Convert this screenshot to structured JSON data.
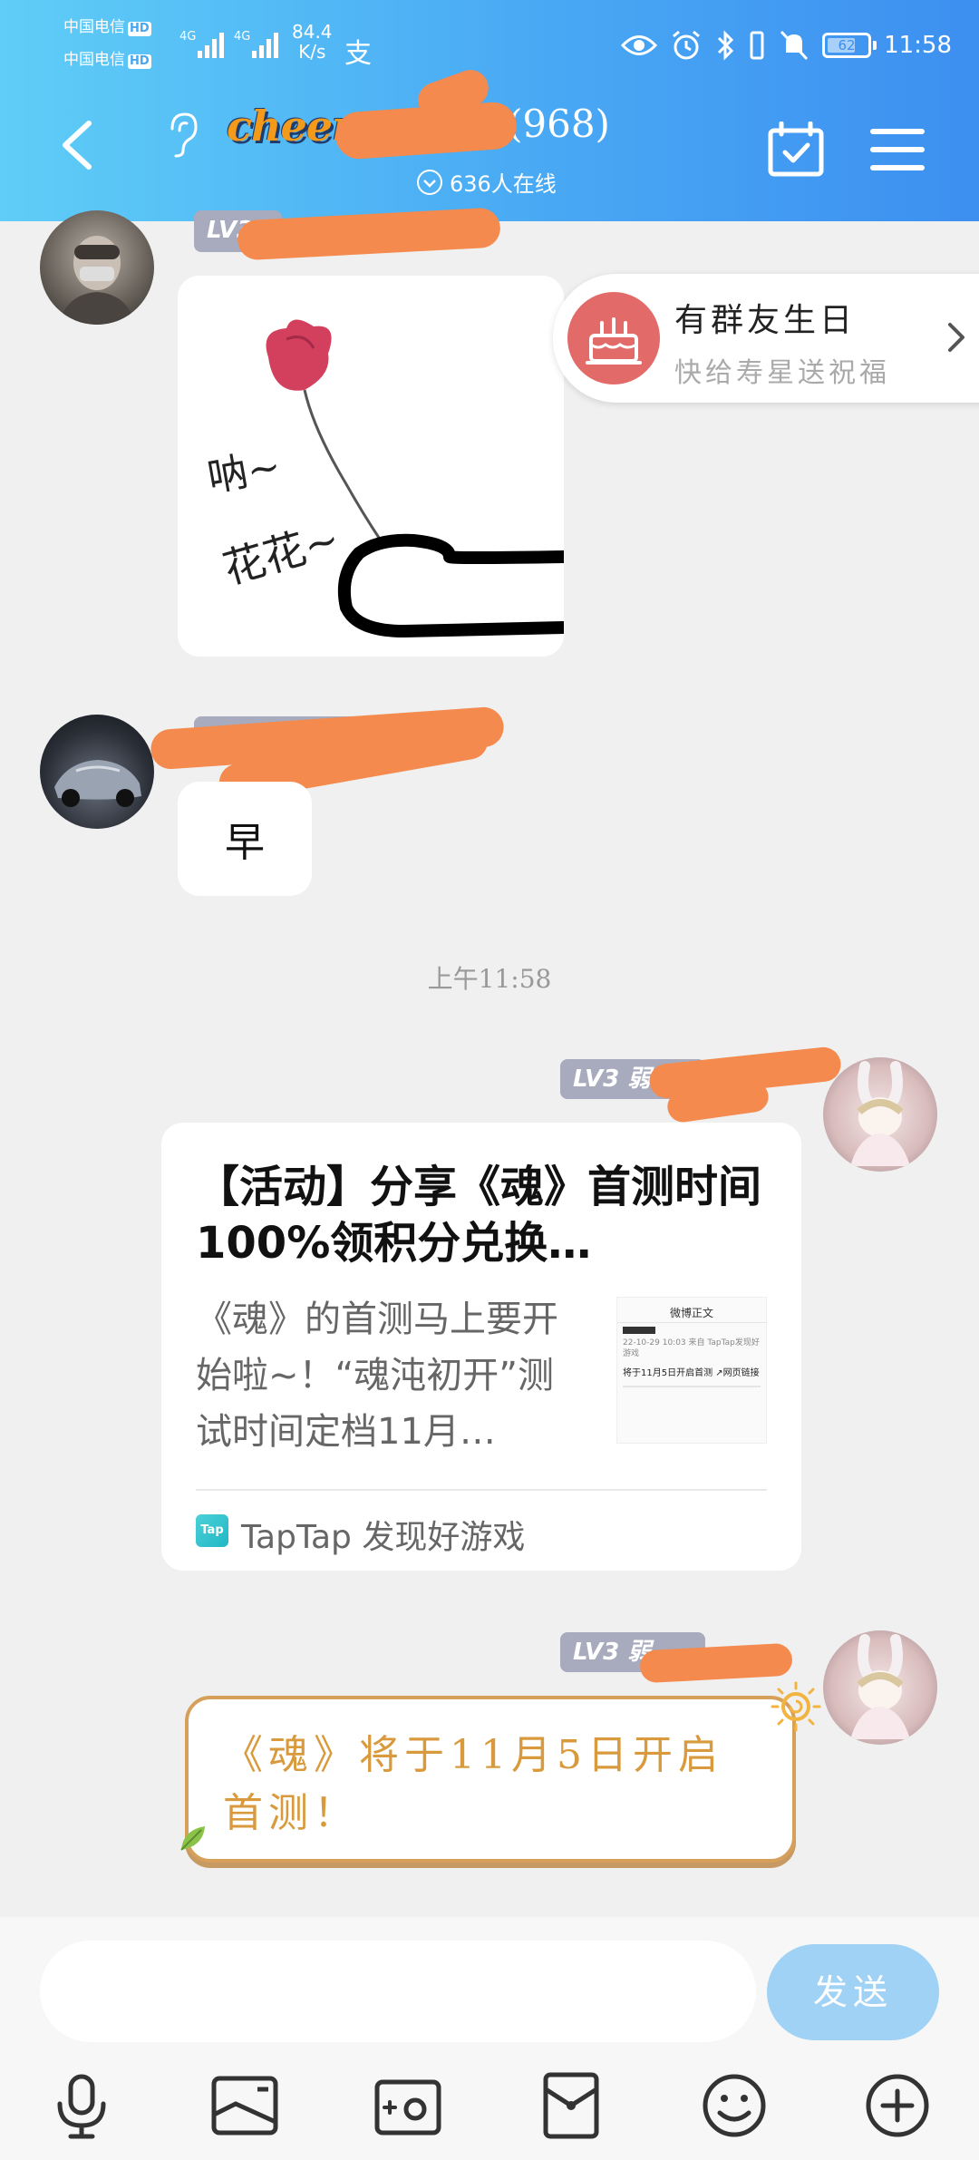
{
  "status_bar": {
    "carrier_1": "中国电信",
    "carrier_2": "中国电信",
    "hd_label": "HD",
    "net_type_1": "4G",
    "net_type_2": "4G",
    "speed_value": "84.4",
    "speed_unit": "K/s",
    "alipay_glyph": "支",
    "battery_level": "62",
    "time": "11:58"
  },
  "header": {
    "logo_text": "cheers",
    "group_member_count": "(968)",
    "online_text": "636人在线"
  },
  "birthday_banner": {
    "title": "有群友生日",
    "subtitle": "快给寿星送祝福"
  },
  "messages": {
    "m1": {
      "level": "LV38"
    },
    "m1_sticker_text_1": "呐~",
    "m1_sticker_text_2": "花花~",
    "m2": {
      "text": "早"
    },
    "time_divider": "上午11:58",
    "m3": {
      "level": "LV3 弱",
      "card_title": "【活动】分享《魂》首测时间 100%领积分兑换…",
      "card_desc": "《魂》的首测马上要开始啦~！“魂沌初开”测试时间定档11月…",
      "thumb_header": "微博正文",
      "thumb_meta": "22-10-29 10:03 来自 TapTap发现好游戏",
      "thumb_line": "将于11月5日开启首测 ↗网页链接",
      "source_icon": "Tap",
      "source_name": "TapTap 发现好游戏"
    },
    "m4": {
      "level": "LV3 弱",
      "text": "《魂》将于11月5日开启首测！"
    }
  },
  "input": {
    "placeholder": "",
    "send_label": "发送"
  },
  "colors": {
    "header_gradient_start": "#5fcdf7",
    "header_gradient_end": "#3d8ff0",
    "redaction": "#f48a4d",
    "level_badge": "#a7abbd",
    "send_button": "#9fd2f5",
    "deco_text": "#d89a3c"
  },
  "icons": {
    "back": "back-arrow-icon",
    "ear": "ear-icon",
    "calendar": "calendar-check-icon",
    "menu": "hamburger-menu-icon",
    "toolbar": [
      "microphone-icon",
      "image-icon",
      "camera-icon",
      "red-packet-icon",
      "emoji-icon",
      "plus-icon"
    ]
  }
}
